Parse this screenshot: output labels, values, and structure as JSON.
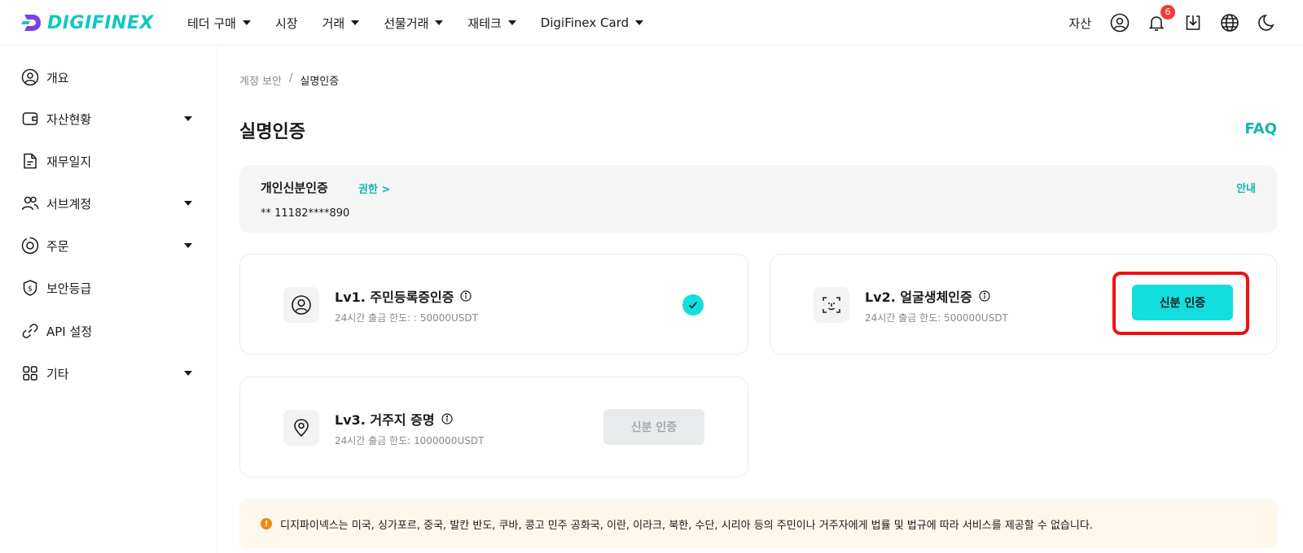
{
  "header": {
    "logo_text": "DIGIFINEX",
    "nav": [
      {
        "label": "테더 구매",
        "has_caret": true
      },
      {
        "label": "시장",
        "has_caret": false
      },
      {
        "label": "거래",
        "has_caret": true
      },
      {
        "label": "선물거래",
        "has_caret": true
      },
      {
        "label": "재테크",
        "has_caret": true
      },
      {
        "label": "DigiFinex Card",
        "has_caret": true
      }
    ],
    "asset_label": "자산",
    "notification_count": "6",
    "icons": [
      "user-icon",
      "bell-icon",
      "download-icon",
      "globe-icon",
      "moon-icon"
    ]
  },
  "sidebar": {
    "items": [
      {
        "label": "개요",
        "icon": "user-circle-icon",
        "has_caret": false
      },
      {
        "label": "자산현황",
        "icon": "wallet-icon",
        "has_caret": true
      },
      {
        "label": "재무일지",
        "icon": "document-icon",
        "has_caret": false
      },
      {
        "label": "서브계정",
        "icon": "users-icon",
        "has_caret": true
      },
      {
        "label": "주문",
        "icon": "order-icon",
        "has_caret": true
      },
      {
        "label": "보안등급",
        "icon": "shield-icon",
        "has_caret": false
      },
      {
        "label": "API 설정",
        "icon": "link-icon",
        "has_caret": false
      },
      {
        "label": "기타",
        "icon": "grid-icon",
        "has_caret": true
      }
    ]
  },
  "breadcrumb": {
    "parent": "계정 보안",
    "separator": "/",
    "current": "실명인증"
  },
  "page": {
    "title": "실명인증",
    "faq": "FAQ"
  },
  "identity": {
    "title": "개인신분인증",
    "permission_link": "권한 >",
    "guide_link": "안내",
    "id_number": "** 11182****890"
  },
  "levels": [
    {
      "title": "Lv1. 주민등록증인증",
      "limit": "24시간 출금 한도: : 50000USDT",
      "status": "verified",
      "icon": "user-circle-icon"
    },
    {
      "title": "Lv2. 얼굴생체인증",
      "limit": "24시간 출금 한도: 500000USDT",
      "status": "available",
      "button": "신분 인증",
      "icon": "face-scan-icon"
    },
    {
      "title": "Lv3. 거주지 증명",
      "limit": "24시간 출금 한도: 1000000USDT",
      "status": "disabled",
      "button": "신분 인증",
      "icon": "location-pin-icon"
    }
  ],
  "notice": {
    "icon": "!",
    "text": "디지파이넥스는 미국, 싱가포르, 중국, 발칸 반도, 쿠바, 콩고 민주 공화국, 이란, 이라크, 북한, 수단, 시리아 등의 주민이나 거주자에게 법률 및 법규에 따라 서비스를 제공할 수 없습니다."
  },
  "colors": {
    "accent": "#12b5ad",
    "button": "#12dede",
    "highlight": "#f01010",
    "notice_bg": "#fdf7ec",
    "badge": "#f43a3a"
  }
}
